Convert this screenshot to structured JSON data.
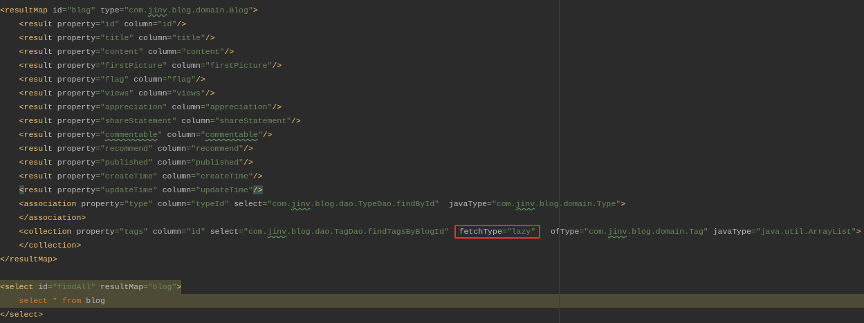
{
  "editor": {
    "lines": [
      {
        "tokens": [
          {
            "kind": "tag",
            "text": "<resultMap"
          },
          {
            "kind": "attr",
            "text": " id"
          },
          {
            "kind": "value",
            "text": "=\"blog\""
          },
          {
            "kind": "attr",
            "text": " type"
          },
          {
            "kind": "value",
            "text": "=\"com."
          },
          {
            "kind": "value",
            "text": "jinv",
            "misspelled": true
          },
          {
            "kind": "value",
            "text": ".blog.domain.Blog\""
          },
          {
            "kind": "tag",
            "text": ">"
          }
        ]
      },
      {
        "tokens": [
          {
            "kind": "tag",
            "text": "    <result"
          },
          {
            "kind": "attr",
            "text": " property"
          },
          {
            "kind": "value",
            "text": "=\"id\""
          },
          {
            "kind": "attr",
            "text": " column"
          },
          {
            "kind": "value",
            "text": "=\"id\""
          },
          {
            "kind": "tag",
            "text": "/>"
          }
        ]
      },
      {
        "tokens": [
          {
            "kind": "tag",
            "text": "    <result"
          },
          {
            "kind": "attr",
            "text": " property"
          },
          {
            "kind": "value",
            "text": "=\"title\""
          },
          {
            "kind": "attr",
            "text": " column"
          },
          {
            "kind": "value",
            "text": "=\"title\""
          },
          {
            "kind": "tag",
            "text": "/>"
          }
        ]
      },
      {
        "tokens": [
          {
            "kind": "tag",
            "text": "    <result"
          },
          {
            "kind": "attr",
            "text": " property"
          },
          {
            "kind": "value",
            "text": "=\"content\""
          },
          {
            "kind": "attr",
            "text": " column"
          },
          {
            "kind": "value",
            "text": "=\"content\""
          },
          {
            "kind": "tag",
            "text": "/>"
          }
        ]
      },
      {
        "tokens": [
          {
            "kind": "tag",
            "text": "    <result"
          },
          {
            "kind": "attr",
            "text": " property"
          },
          {
            "kind": "value",
            "text": "=\"firstPicture\""
          },
          {
            "kind": "attr",
            "text": " column"
          },
          {
            "kind": "value",
            "text": "=\"firstPicture\""
          },
          {
            "kind": "tag",
            "text": "/>"
          }
        ]
      },
      {
        "tokens": [
          {
            "kind": "tag",
            "text": "    <result"
          },
          {
            "kind": "attr",
            "text": " property"
          },
          {
            "kind": "value",
            "text": "=\"flag\""
          },
          {
            "kind": "attr",
            "text": " column"
          },
          {
            "kind": "value",
            "text": "=\"flag\""
          },
          {
            "kind": "tag",
            "text": "/>"
          }
        ]
      },
      {
        "tokens": [
          {
            "kind": "tag",
            "text": "    <result"
          },
          {
            "kind": "attr",
            "text": " property"
          },
          {
            "kind": "value",
            "text": "=\"views\""
          },
          {
            "kind": "attr",
            "text": " column"
          },
          {
            "kind": "value",
            "text": "=\"views\""
          },
          {
            "kind": "tag",
            "text": "/>"
          }
        ]
      },
      {
        "tokens": [
          {
            "kind": "tag",
            "text": "    <result"
          },
          {
            "kind": "attr",
            "text": " property"
          },
          {
            "kind": "value",
            "text": "=\"appreciation\""
          },
          {
            "kind": "attr",
            "text": " column"
          },
          {
            "kind": "value",
            "text": "=\"appreciation\""
          },
          {
            "kind": "tag",
            "text": "/>"
          }
        ]
      },
      {
        "tokens": [
          {
            "kind": "tag",
            "text": "    <result"
          },
          {
            "kind": "attr",
            "text": " property"
          },
          {
            "kind": "value",
            "text": "=\"shareStatement\""
          },
          {
            "kind": "attr",
            "text": " column"
          },
          {
            "kind": "value",
            "text": "=\"shareStatement\""
          },
          {
            "kind": "tag",
            "text": "/>"
          }
        ]
      },
      {
        "tokens": [
          {
            "kind": "tag",
            "text": "    <result"
          },
          {
            "kind": "attr",
            "text": " property"
          },
          {
            "kind": "value",
            "text": "=\""
          },
          {
            "kind": "value",
            "text": "commentable",
            "misspelled": true
          },
          {
            "kind": "value",
            "text": "\""
          },
          {
            "kind": "attr",
            "text": " column"
          },
          {
            "kind": "value",
            "text": "=\""
          },
          {
            "kind": "value",
            "text": "commentable",
            "misspelled": true
          },
          {
            "kind": "value",
            "text": "\""
          },
          {
            "kind": "tag",
            "text": "/>"
          }
        ]
      },
      {
        "tokens": [
          {
            "kind": "tag",
            "text": "    <result"
          },
          {
            "kind": "attr",
            "text": " property"
          },
          {
            "kind": "value",
            "text": "=\"recommend\""
          },
          {
            "kind": "attr",
            "text": " column"
          },
          {
            "kind": "value",
            "text": "=\"recommend\""
          },
          {
            "kind": "tag",
            "text": "/>"
          }
        ]
      },
      {
        "tokens": [
          {
            "kind": "tag",
            "text": "    <result"
          },
          {
            "kind": "attr",
            "text": " property"
          },
          {
            "kind": "value",
            "text": "=\"published\""
          },
          {
            "kind": "attr",
            "text": " column"
          },
          {
            "kind": "value",
            "text": "=\"published\""
          },
          {
            "kind": "tag",
            "text": "/>"
          }
        ]
      },
      {
        "tokens": [
          {
            "kind": "tag",
            "text": "    <result"
          },
          {
            "kind": "attr",
            "text": " property"
          },
          {
            "kind": "value",
            "text": "=\"createTime\""
          },
          {
            "kind": "attr",
            "text": " column"
          },
          {
            "kind": "value",
            "text": "=\"createTime\""
          },
          {
            "kind": "tag",
            "text": "/>"
          }
        ]
      },
      {
        "tokens": [
          {
            "kind": "tag",
            "text": "    <",
            "matched": true
          },
          {
            "kind": "tag",
            "text": "result"
          },
          {
            "kind": "attr",
            "text": " property"
          },
          {
            "kind": "value",
            "text": "=\"updateTime\""
          },
          {
            "kind": "attr",
            "text": " column"
          },
          {
            "kind": "value",
            "text": "=\"updateTime\""
          },
          {
            "kind": "tag",
            "text": "/>",
            "matched": true
          }
        ]
      },
      {
        "tokens": [
          {
            "kind": "tag",
            "text": "    <association"
          },
          {
            "kind": "attr",
            "text": " property"
          },
          {
            "kind": "value",
            "text": "=\"type\""
          },
          {
            "kind": "attr",
            "text": " column"
          },
          {
            "kind": "value",
            "text": "=\"typeId\""
          },
          {
            "kind": "attr",
            "text": " select"
          },
          {
            "kind": "value",
            "text": "=\"com."
          },
          {
            "kind": "value",
            "text": "jinv",
            "misspelled": true
          },
          {
            "kind": "value",
            "text": ".blog.dao.TypeDao.findById\""
          },
          {
            "kind": "attr",
            "text": "  javaType"
          },
          {
            "kind": "value",
            "text": "=\"com."
          },
          {
            "kind": "value",
            "text": "jinv",
            "misspelled": true
          },
          {
            "kind": "value",
            "text": ".blog.domain.Type\""
          },
          {
            "kind": "tag",
            "text": ">"
          }
        ]
      },
      {
        "tokens": [
          {
            "kind": "tag",
            "text": "    </association>"
          }
        ]
      },
      {
        "tokens": [
          {
            "kind": "tag",
            "text": "    <collection"
          },
          {
            "kind": "attr",
            "text": " property"
          },
          {
            "kind": "value",
            "text": "=\"tags\""
          },
          {
            "kind": "attr",
            "text": " column"
          },
          {
            "kind": "value",
            "text": "=\"id\""
          },
          {
            "kind": "attr",
            "text": " select"
          },
          {
            "kind": "value",
            "text": "=\"com."
          },
          {
            "kind": "value",
            "text": "jinv",
            "misspelled": true
          },
          {
            "kind": "value",
            "text": ".blog.dao.TagDao.findTagsByBlogId\" "
          },
          {
            "kind": "attr",
            "text": "fetchType",
            "boxed": true
          },
          {
            "kind": "value",
            "text": "=\"lazy\"",
            "boxed": true
          },
          {
            "kind": "attr",
            "text": "  ofType"
          },
          {
            "kind": "value",
            "text": "=\"com."
          },
          {
            "kind": "value",
            "text": "jinv",
            "misspelled": true
          },
          {
            "kind": "value",
            "text": ".blog.domain.Tag\""
          },
          {
            "kind": "attr",
            "text": " javaType"
          },
          {
            "kind": "value",
            "text": "=\"java.util.ArrayList\""
          },
          {
            "kind": "tag",
            "text": ">"
          }
        ]
      },
      {
        "tokens": [
          {
            "kind": "tag",
            "text": "    </collection>"
          }
        ]
      },
      {
        "tokens": [
          {
            "kind": "tag",
            "text": "</resultMap>"
          }
        ]
      },
      {
        "kind": "blank"
      },
      {
        "kind": "code",
        "highlighted": true,
        "tokens": [
          {
            "kind": "tag",
            "text": "<select"
          },
          {
            "kind": "attr",
            "text": " id"
          },
          {
            "kind": "value",
            "text": "=\"findAll\""
          },
          {
            "kind": "attr",
            "text": " resultMap"
          },
          {
            "kind": "value",
            "text": "=\"blog\""
          },
          {
            "kind": "tag",
            "text": ">"
          }
        ]
      },
      {
        "current_line": true,
        "tokens": [
          {
            "kind": "sql_keyword",
            "text": "    select"
          },
          {
            "kind": "sql_keyword",
            "text": " *"
          },
          {
            "kind": "sql_keyword",
            "text": " from"
          },
          {
            "kind": "sql_text",
            "text": " blog"
          }
        ]
      },
      {
        "tokens": [
          {
            "kind": "tag",
            "text": "</select>"
          }
        ]
      }
    ]
  }
}
